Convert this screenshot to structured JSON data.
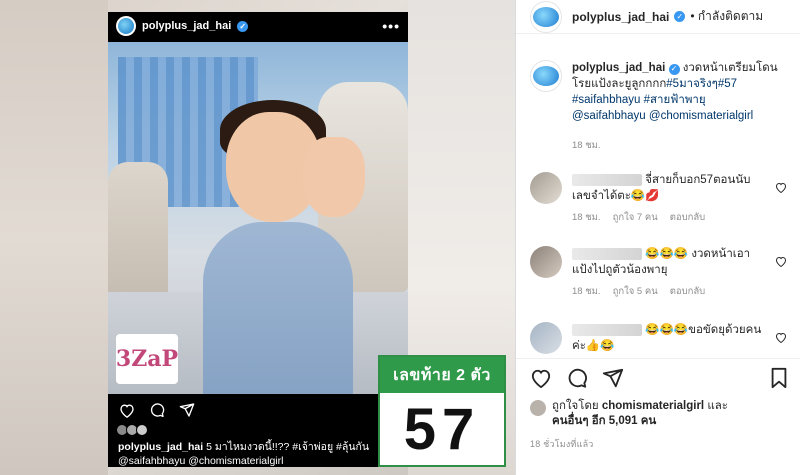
{
  "inner_post": {
    "username": "polyplus_jad_hai",
    "more": "•••",
    "caption_user": "polyplus_jad_hai",
    "caption_text": " 5 มาไหมงวดนี้!!?? #เจ้าพ่อยู #ลุ้นกัน",
    "caption_line2": "@saifahbhayu @chomismaterialgirl",
    "logo_text": "3ZaP"
  },
  "overlay": {
    "label": "เลขท้าย 2 ตัว",
    "number": "57"
  },
  "header": {
    "username": "polyplus_jad_hai",
    "follow_status": "• กำลังติดตาม"
  },
  "caption": {
    "username": "polyplus_jad_hai",
    "text": " งวดหน้าเตรียมโดนโรยแป้งละยูลูกกกก",
    "tags1": "#5มาจริงๆ#57",
    "tags2": "#saifahbhayu #สายฟ้าพายุ",
    "mentions": "@saifahbhayu @chomismaterialgirl",
    "time": "18 ชม."
  },
  "comments": [
    {
      "text": "จี่สายก็บอก57ตอนนับเลขจำได้ตะ😂💋",
      "time": "18 ชม.",
      "likes": "ถูกใจ 7 คน",
      "reply": "ตอบกลับ"
    },
    {
      "text": "😂😂😂 งวดหน้าเอาแป้งไปถูตัวน้องพายุ",
      "time": "18 ชม.",
      "likes": "ถูกใจ 5 คน",
      "reply": "ตอบกลับ"
    },
    {
      "text": "😂😂😂ขอขัดยุด้วยคนค่ะ👍😂",
      "time": "",
      "likes": "",
      "reply": ""
    }
  ],
  "actions": {
    "liked_by_prefix": "ถูกใจโดย ",
    "liked_by_user": "chomismaterialgirl",
    "liked_by_suffix": " และ",
    "liked_by_others": "คนอื่นๆ อีก 5,091 คน",
    "time_ago": "18 ชั่วโมงที่แล้ว"
  }
}
